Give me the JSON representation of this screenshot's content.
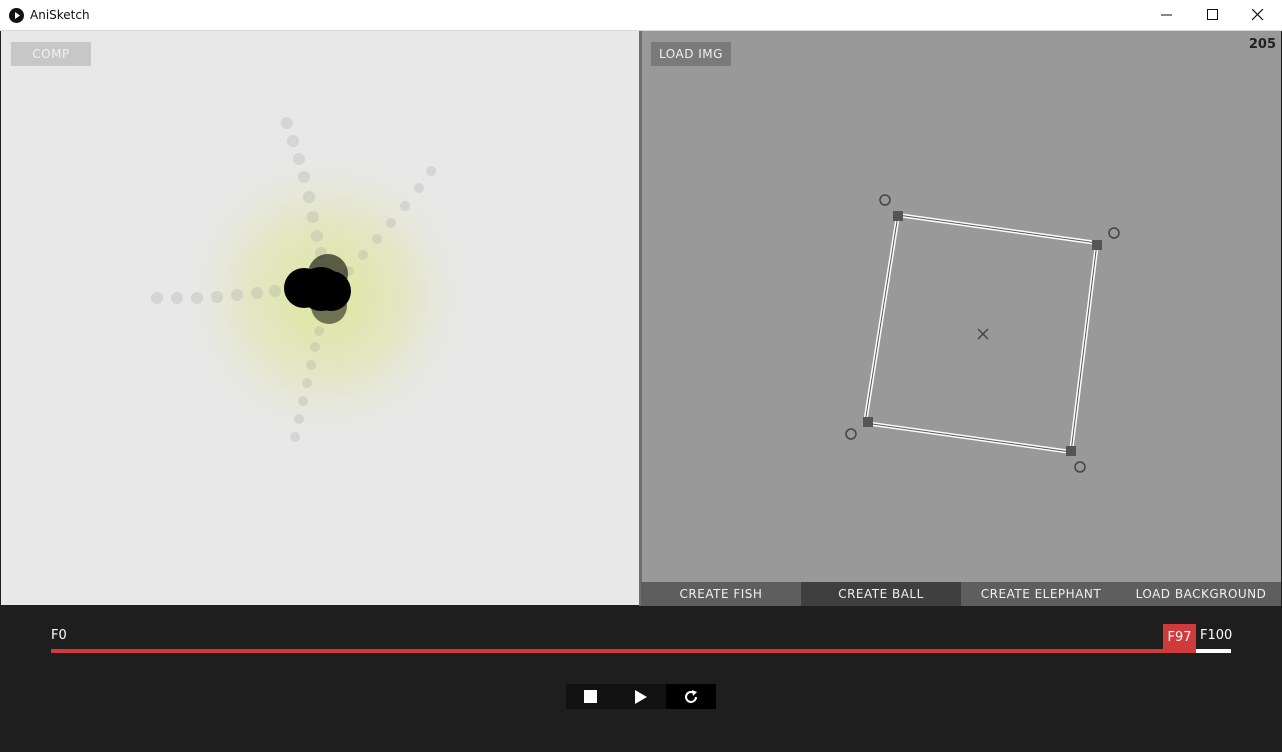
{
  "window": {
    "title": "AniSketch",
    "controls": [
      "minimize-icon",
      "maximize-icon",
      "close-icon"
    ]
  },
  "left_panel": {
    "comp_button": "COMP"
  },
  "right_panel": {
    "load_img_button": "LOAD IMG",
    "counter": "205",
    "tabs": [
      {
        "label": "CREATE FISH",
        "active": false
      },
      {
        "label": "CREATE BALL",
        "active": true
      },
      {
        "label": "CREATE ELEPHANT",
        "active": false
      },
      {
        "label": "LOAD BACKGROUND",
        "active": false
      }
    ]
  },
  "timeline": {
    "start_label": "F0",
    "current_label": "F97",
    "end_label": "F100",
    "current_frame": 97,
    "total_frames": 100
  },
  "playback": {
    "buttons": [
      "stop-icon",
      "play-icon",
      "loop-icon"
    ]
  },
  "colors": {
    "accent": "#d13a3a",
    "glow": "#dfe8a0"
  }
}
